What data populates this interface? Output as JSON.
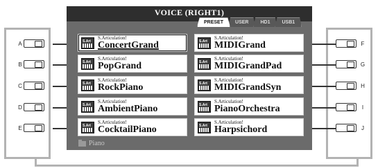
{
  "screen": {
    "title": "VOICE (RIGHT1)",
    "tabs": [
      {
        "label": "PRESET",
        "active": true
      },
      {
        "label": "USER",
        "active": false
      },
      {
        "label": "HD1",
        "active": false
      },
      {
        "label": "USB1",
        "active": false
      }
    ],
    "voices_left": [
      {
        "tag": "S.Articulation!",
        "name": "ConcertGrand",
        "selected": true
      },
      {
        "tag": "S.Articulation!",
        "name": "PopGrand"
      },
      {
        "tag": "S.Articulation!",
        "name": "RockPiano"
      },
      {
        "tag": "S.Articulation!",
        "name": "AmbientPiano"
      },
      {
        "tag": "S.Articulation!",
        "name": "CocktailPiano"
      }
    ],
    "voices_right": [
      {
        "tag": "S.Articulation!",
        "name": "MIDIGrand"
      },
      {
        "tag": "S.Articulation!",
        "name": "MIDIGrandPad"
      },
      {
        "tag": "S.Articulation!",
        "name": "MIDIGrandSyn"
      },
      {
        "tag": "S.Articulation!",
        "name": "PianoOrchestra"
      },
      {
        "tag": "S.Articulation!",
        "name": "Harpsichord"
      }
    ],
    "folder": "Piano",
    "icon_badge": "S.Art"
  },
  "buttons_left": [
    "A",
    "B",
    "C",
    "D",
    "E"
  ],
  "buttons_right": [
    "F",
    "G",
    "H",
    "I",
    "J"
  ]
}
